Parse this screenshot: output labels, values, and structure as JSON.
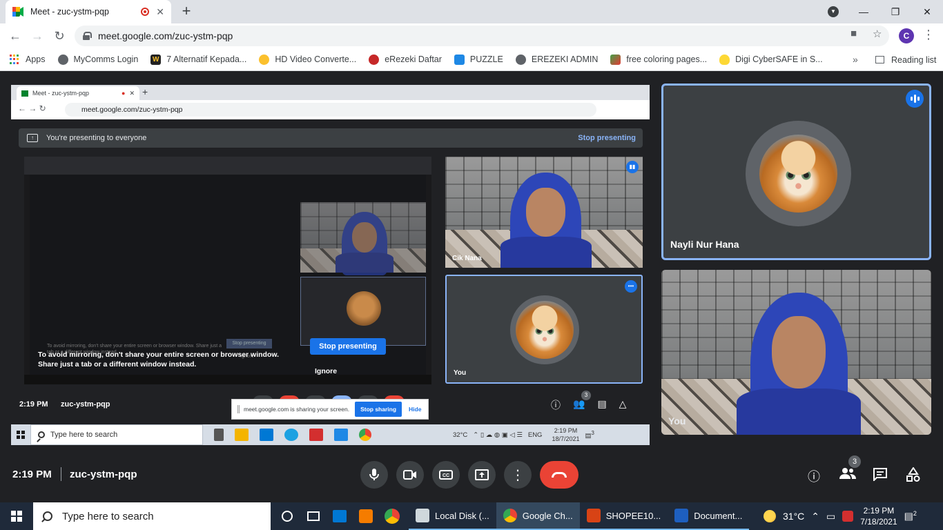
{
  "browser": {
    "tab_title": "Meet - zuc-ystm-pqp",
    "tab_close": "✕",
    "new_tab": "+",
    "url": "meet.google.com/zuc-ystm-pqp",
    "profile_initial": "C",
    "win_min": "—",
    "win_max": "❐",
    "win_close": "✕"
  },
  "bookmarks": {
    "items": [
      {
        "label": "Apps",
        "color": ""
      },
      {
        "label": "MyComms Login",
        "color": "#5f6368"
      },
      {
        "label": "7 Alternatif Kepada...",
        "color": "#222222"
      },
      {
        "label": "HD Video Converte...",
        "color": "#fbc02d"
      },
      {
        "label": "eRezeki Daftar",
        "color": "#c62828"
      },
      {
        "label": "PUZZLE",
        "color": "#1e88e5"
      },
      {
        "label": "EREZEKI ADMIN",
        "color": "#5f6368"
      },
      {
        "label": "free coloring pages...",
        "color": "#e53935"
      },
      {
        "label": "Digi CyberSAFE in S...",
        "color": "#fdd835"
      }
    ],
    "more": "»",
    "reading_list": "Reading list"
  },
  "share": {
    "tab_title": "Meet - zuc-ystm-pqp",
    "url": "meet.google.com/zuc-ystm-pqp",
    "banner_text": "You're presenting to everyone",
    "banner_stop": "Stop presenting",
    "mirror_text": "To avoid mirroring, don't share your entire screen or browser window. Share just a tab or a different window instead.",
    "mirror_btn": "Stop presenting",
    "mirror_ignore": "Ignore",
    "tile_a_name": "Cik Nana",
    "tile_b_name": "You",
    "warning": "To avoid mirroring, don't share your entire screen or browser window. Share just a tab or a different window instead.",
    "stop_btn": "Stop presenting",
    "ignore": "Ignore",
    "time": "2:19 PM",
    "code": "zuc-ystm-pqp",
    "participants_count": "3",
    "share_note": "meet.google.com is sharing your screen.",
    "share_stop": "Stop sharing",
    "share_hide": "Hide",
    "search_placeholder": "Type here to search",
    "temp": "32°C",
    "lang": "ENG",
    "clock_time": "2:19 PM",
    "clock_date": "18/7/2021",
    "notif_count": "3"
  },
  "tiles": {
    "nayli_name": "Nayli Nur Hana",
    "you_name": "You"
  },
  "meet_bar": {
    "time": "2:19 PM",
    "separator": "|",
    "code": "zuc-ystm-pqp",
    "participants_count": "3"
  },
  "taskbar": {
    "search_placeholder": "Type here to search",
    "apps": [
      {
        "label": "Local Disk (...",
        "color": "#cfd8dc"
      },
      {
        "label": "Google Ch...",
        "color": "#34a853"
      },
      {
        "label": "SHOPEE10...",
        "color": "#d84315"
      },
      {
        "label": "Document...",
        "color": "#1e5fbf"
      }
    ],
    "temp": "31°C",
    "clock_time": "2:19 PM",
    "clock_date": "7/18/2021",
    "notif_count": "2"
  }
}
